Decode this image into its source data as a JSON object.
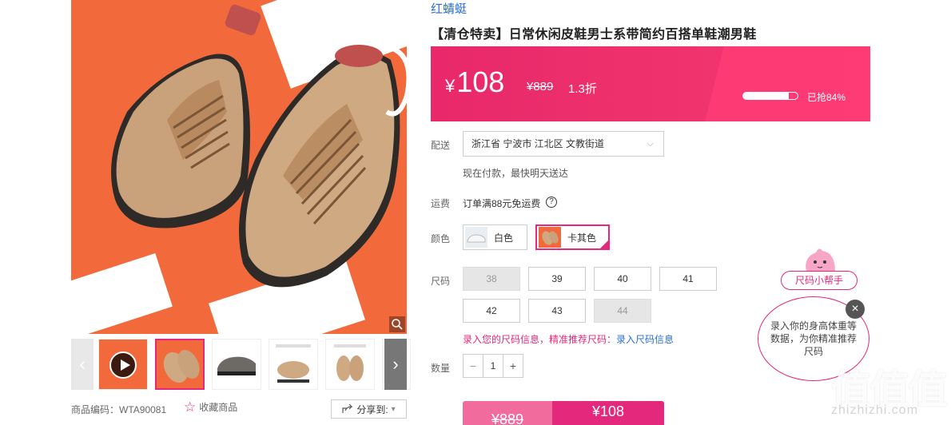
{
  "gallery": {
    "prev_arrow": "‹",
    "next_arrow": "›",
    "thumbnails": [
      "video",
      "khaki-angle",
      "gray-side",
      "detail-sheet",
      "khaki-sole",
      "khaki-pair"
    ]
  },
  "product": {
    "brand": "红蜻蜓",
    "title": "【清仓特卖】日常休闲皮鞋男士系带简约百搭单鞋潮男鞋",
    "sku_code": "商品编码：WTA90081",
    "favorite_label": "收藏商品",
    "share_label": "分享到:"
  },
  "price": {
    "currency": "¥",
    "current": "108",
    "original": "¥889",
    "discount": "1.3折",
    "sold_text": "已抢84%",
    "sold_fraction": 0.84
  },
  "delivery": {
    "label": "配送",
    "address": "浙江省 宁波市 江北区 文教街道",
    "note": "现在付款，最快明天送达"
  },
  "shipping": {
    "label": "运费",
    "text": "订单满88元免运费"
  },
  "color": {
    "label": "颜色",
    "options": [
      {
        "name": "白色",
        "selected": false
      },
      {
        "name": "卡其色",
        "selected": true
      }
    ]
  },
  "size": {
    "label": "尺码",
    "options": [
      {
        "value": "38",
        "available": false
      },
      {
        "value": "39",
        "available": true
      },
      {
        "value": "40",
        "available": true
      },
      {
        "value": "41",
        "available": true
      },
      {
        "value": "42",
        "available": true
      },
      {
        "value": "43",
        "available": true
      },
      {
        "value": "44",
        "available": false
      }
    ],
    "tip_text": "录入您的尺码信息，精准推荐尺码：",
    "tip_link": "录入尺码信息"
  },
  "quantity": {
    "label": "数量",
    "value": "1",
    "minus": "−",
    "plus": "+"
  },
  "buy_bar": {
    "original": "¥889",
    "current": "¥108"
  },
  "size_helper": {
    "title": "尺码小帮手",
    "message": "录入你的身高体重等数据，为你精准推荐尺码",
    "close": "×"
  },
  "watermark": {
    "logo": "值值值",
    "url": "zhizhizhi.com"
  },
  "colors": {
    "accent": "#e4287c",
    "link": "#2a6fcf",
    "photo_bg": "#f26a3c"
  }
}
